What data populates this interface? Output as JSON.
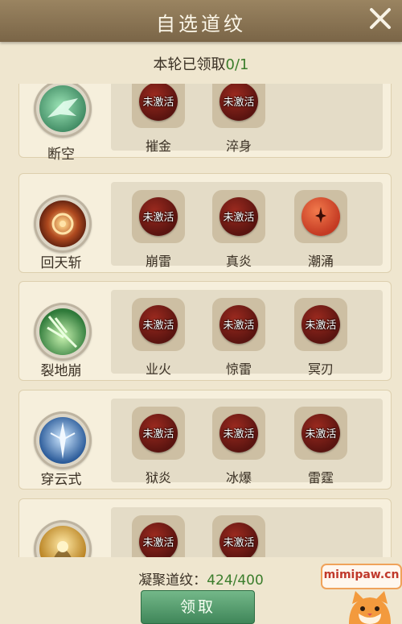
{
  "header": {
    "title": "自选道纹"
  },
  "round": {
    "prefix": "本轮已领取",
    "count": "0/1"
  },
  "locked_label": "未激活",
  "skills": [
    {
      "name": "断空",
      "slots": [
        "摧金",
        "淬身"
      ]
    },
    {
      "name": "回天斩",
      "slots": [
        "崩雷",
        "真炎",
        "潮涌"
      ]
    },
    {
      "name": "裂地崩",
      "slots": [
        "业火",
        "惊雷",
        "冥刃"
      ]
    },
    {
      "name": "穿云式",
      "slots": [
        "狱炎",
        "冰爆",
        "雷霆"
      ]
    },
    {
      "name": "",
      "slots": [
        "",
        ""
      ]
    }
  ],
  "footer": {
    "label": "凝聚道纹：",
    "value": "424/400"
  },
  "claim_button": "领取",
  "watermark": "mimipaw.cn"
}
